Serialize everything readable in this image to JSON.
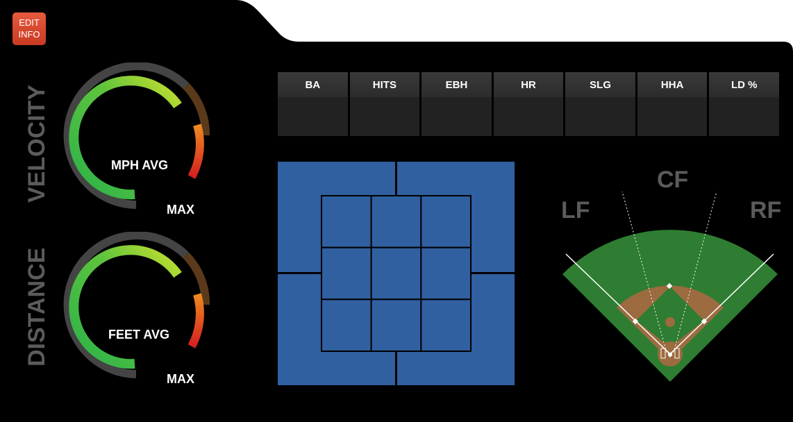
{
  "edit_button": {
    "line1": "EDIT",
    "line2": "INFO"
  },
  "velocity": {
    "title": "VELOCITY",
    "avg_label": "MPH AVG",
    "max_label": "MAX"
  },
  "distance": {
    "title": "DISTANCE",
    "avg_label": "FEET AVG",
    "max_label": "MAX"
  },
  "stats": {
    "columns": [
      "BA",
      "HITS",
      "EBH",
      "HR",
      "SLG",
      "HHA",
      "LD %"
    ],
    "values": [
      "",
      "",
      "",
      "",
      "",
      "",
      ""
    ]
  },
  "strike_zone": {
    "inner_rows": 3,
    "inner_cols": 3,
    "color": "#3060a0"
  },
  "field": {
    "lf": "LF",
    "cf": "CF",
    "rf": "RF"
  },
  "colors": {
    "panel": "#000000",
    "edit_button": "#d9442b",
    "grass": "#2e7d32",
    "dirt": "#9c6b3f",
    "label_gray": "#5b5b5b"
  }
}
